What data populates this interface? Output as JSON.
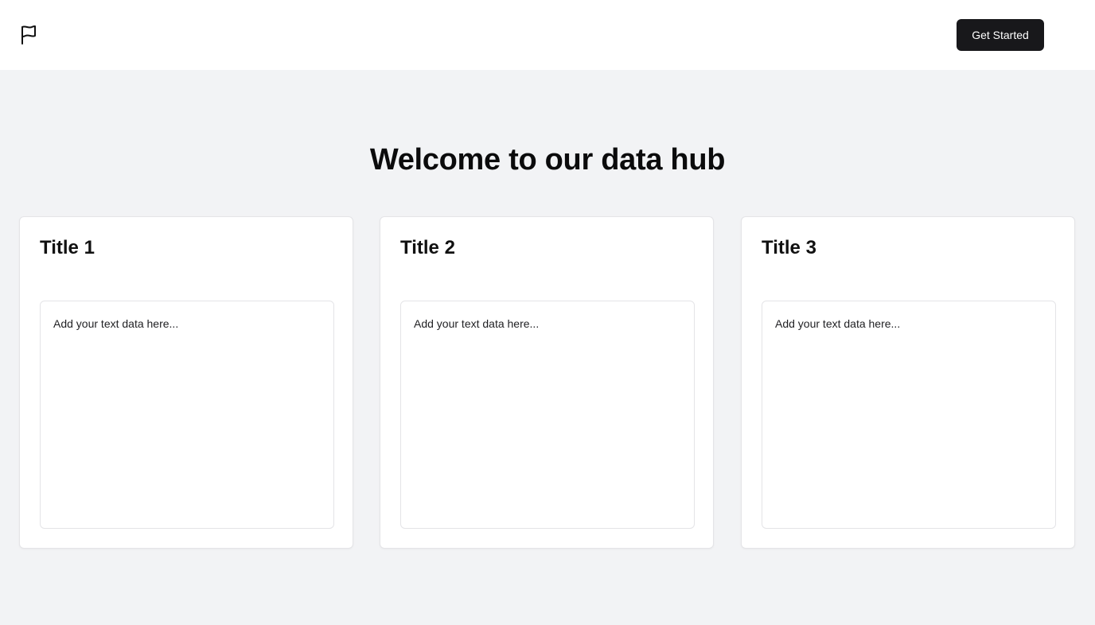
{
  "header": {
    "logo_icon": "flag-icon",
    "cta_label": "Get Started"
  },
  "main": {
    "title": "Welcome to our data hub",
    "cards": [
      {
        "title": "Title 1",
        "textarea_placeholder": "Add your text data here...",
        "textarea_value": ""
      },
      {
        "title": "Title 2",
        "textarea_placeholder": "Add your text data here...",
        "textarea_value": ""
      },
      {
        "title": "Title 3",
        "textarea_placeholder": "Add your text data here...",
        "textarea_value": ""
      }
    ]
  },
  "colors": {
    "page_background": "#f2f3f5",
    "header_background": "#ffffff",
    "button_background": "#18181b",
    "button_text": "#ffffff",
    "card_border": "#e4e4e7"
  }
}
